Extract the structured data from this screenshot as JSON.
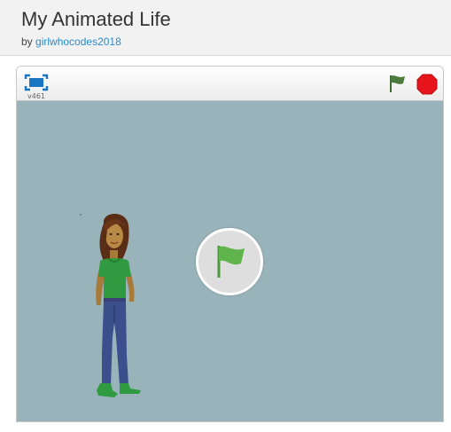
{
  "project": {
    "title": "My Animated Life",
    "by_label": "by",
    "author": "girlwhocodes2018"
  },
  "player": {
    "version": "v461",
    "colors": {
      "stage": "#99b3ba",
      "flag": "#4a7b3c",
      "stop": "#e8141c",
      "big_flag": "#5fb54b"
    },
    "icons": [
      "fullscreen-icon",
      "green-flag-icon",
      "stop-icon",
      "play-flag-icon"
    ]
  }
}
